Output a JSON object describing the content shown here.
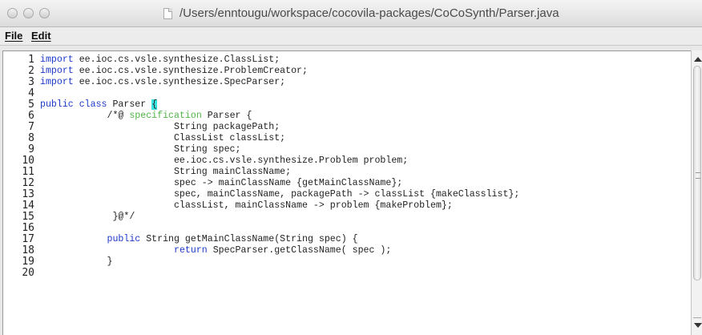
{
  "window": {
    "title": "/Users/enntougu/workspace/cocovila-packages/CoCoSynth/Parser.java"
  },
  "menubar": {
    "items": [
      {
        "label": "File"
      },
      {
        "label": "Edit"
      }
    ]
  },
  "editor": {
    "line_numbers": [
      "1",
      "2",
      "3",
      "4",
      "5",
      "6",
      "7",
      "8",
      "9",
      "10",
      "11",
      "12",
      "13",
      "14",
      "15",
      "16",
      "17",
      "18",
      "19",
      "20"
    ],
    "lines": [
      {
        "segments": [
          {
            "t": "import",
            "c": "kw"
          },
          {
            "t": " ee.ioc.cs.vsle.synthesize.ClassList;",
            "c": ""
          }
        ]
      },
      {
        "segments": [
          {
            "t": "import",
            "c": "kw"
          },
          {
            "t": " ee.ioc.cs.vsle.synthesize.ProblemCreator;",
            "c": ""
          }
        ]
      },
      {
        "segments": [
          {
            "t": "import",
            "c": "kw"
          },
          {
            "t": " ee.ioc.cs.vsle.synthesize.SpecParser;",
            "c": ""
          }
        ]
      },
      {
        "segments": []
      },
      {
        "segments": [
          {
            "t": "public",
            "c": "kw"
          },
          {
            "t": " ",
            "c": ""
          },
          {
            "t": "class",
            "c": "kw"
          },
          {
            "t": " Parser ",
            "c": ""
          },
          {
            "t": "{",
            "c": "hl"
          }
        ]
      },
      {
        "segments": [
          {
            "t": "            /*@ ",
            "c": "cm"
          },
          {
            "t": "specification",
            "c": "spec"
          },
          {
            "t": " Parser {",
            "c": "cm"
          }
        ]
      },
      {
        "segments": [
          {
            "t": "                        String packagePath;",
            "c": ""
          }
        ]
      },
      {
        "segments": [
          {
            "t": "                        ClassList classList;",
            "c": ""
          }
        ]
      },
      {
        "segments": [
          {
            "t": "                        String spec;",
            "c": ""
          }
        ]
      },
      {
        "segments": [
          {
            "t": "                        ee.ioc.cs.vsle.synthesize.Problem problem;",
            "c": ""
          }
        ]
      },
      {
        "segments": [
          {
            "t": "                        String mainClassName;",
            "c": ""
          }
        ]
      },
      {
        "segments": [
          {
            "t": "                        spec -> mainClassName {getMainClassName};",
            "c": ""
          }
        ]
      },
      {
        "segments": [
          {
            "t": "                        spec, mainClassName, packagePath -> classList {makeClasslist};",
            "c": ""
          }
        ]
      },
      {
        "segments": [
          {
            "t": "                        classList, mainClassName -> problem {makeProblem};",
            "c": ""
          }
        ]
      },
      {
        "segments": [
          {
            "t": "             }@*/",
            "c": ""
          }
        ]
      },
      {
        "segments": []
      },
      {
        "segments": [
          {
            "t": "            ",
            "c": ""
          },
          {
            "t": "public",
            "c": "kw"
          },
          {
            "t": " String getMainClassName(String spec) {",
            "c": ""
          }
        ]
      },
      {
        "segments": [
          {
            "t": "                        ",
            "c": ""
          },
          {
            "t": "return",
            "c": "kw"
          },
          {
            "t": " SpecParser.getClassName( spec );",
            "c": ""
          }
        ]
      },
      {
        "segments": [
          {
            "t": "            }",
            "c": ""
          }
        ]
      },
      {
        "segments": []
      }
    ]
  },
  "icons": {
    "close": "close-button-icon",
    "minimize": "minimize-button-icon",
    "zoom": "zoom-button-icon",
    "document": "document-icon",
    "scroll_up": "scroll-up-arrow-icon",
    "scroll_down": "scroll-down-arrow-icon"
  },
  "colors": {
    "keyword": "#1f3ac9",
    "specification": "#52b548",
    "highlight": "#39e3e0"
  }
}
